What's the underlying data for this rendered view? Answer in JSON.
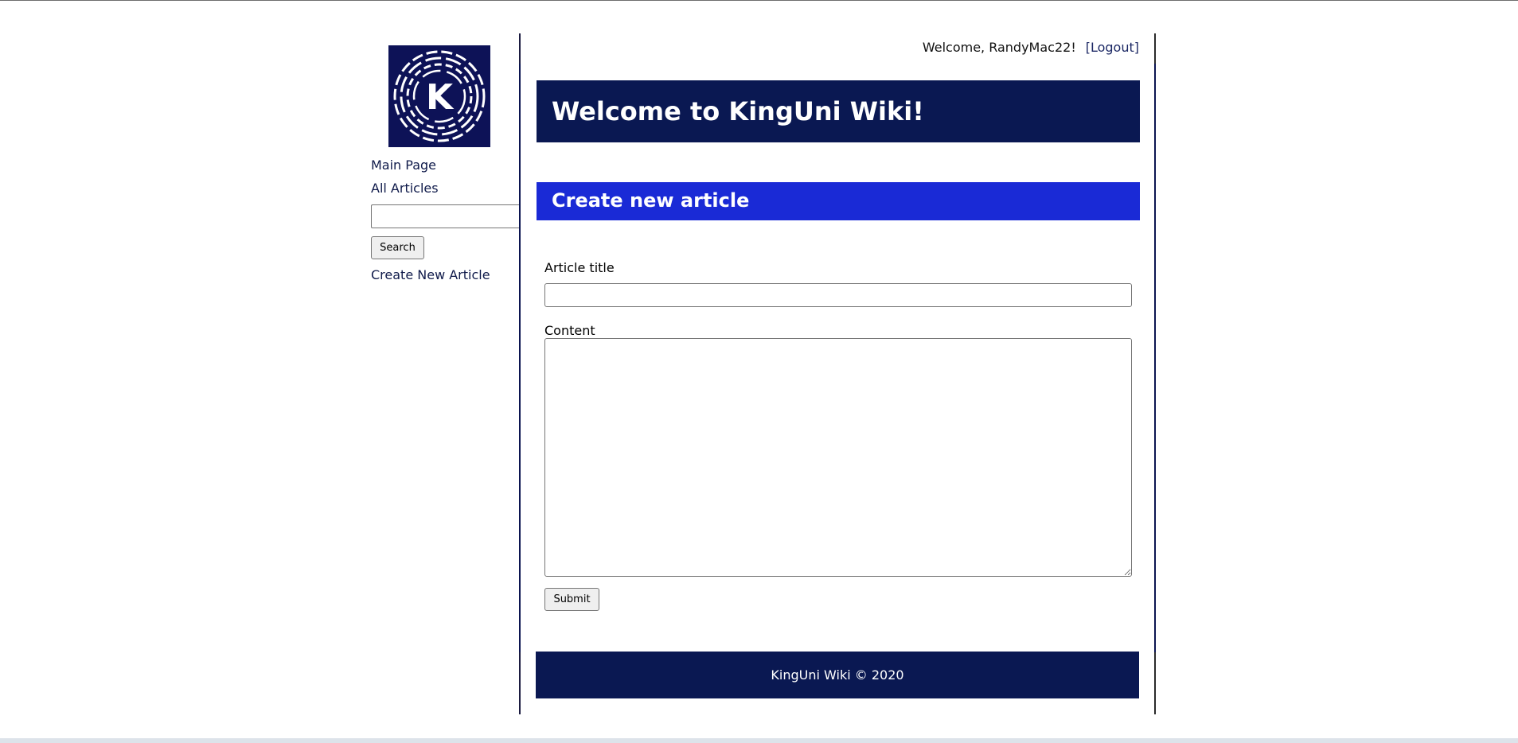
{
  "sidebar": {
    "logo_letter": "K",
    "links": {
      "main_page": "Main Page",
      "all_articles": "All Articles",
      "create_new_article": "Create New Article"
    },
    "search": {
      "value": "",
      "placeholder": "",
      "button_label": "Search"
    }
  },
  "header": {
    "welcome_text": "Welcome, RandyMac22!",
    "logout_label": "[Logout]",
    "hero_title": "Welcome to KingUni Wiki!"
  },
  "section": {
    "title": "Create new article"
  },
  "form": {
    "title_label": "Article title",
    "title_value": "",
    "content_label": "Content",
    "content_value": "",
    "submit_label": "Submit"
  },
  "footer": {
    "text": "KingUni Wiki © 2020"
  },
  "colors": {
    "navy": "#0a1852",
    "section_blue": "#1a2ad6",
    "logo_bg": "#0d1257",
    "link": "#0f1a4a"
  }
}
